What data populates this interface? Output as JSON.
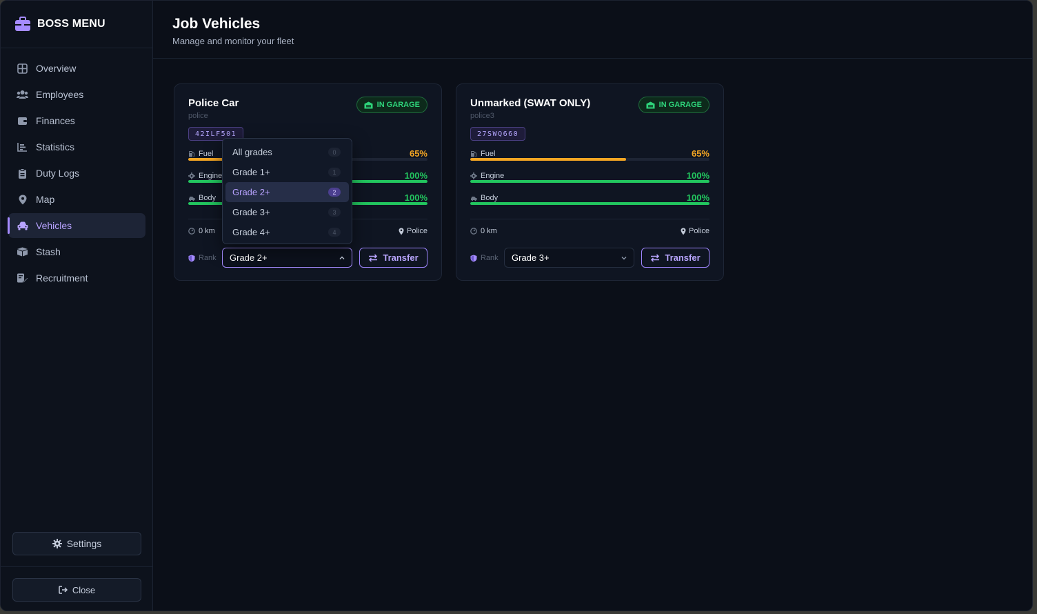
{
  "sidebar": {
    "brand": "BOSS MENU",
    "items": [
      {
        "label": "Overview",
        "icon": "grid-icon"
      },
      {
        "label": "Employees",
        "icon": "users-icon"
      },
      {
        "label": "Finances",
        "icon": "wallet-icon"
      },
      {
        "label": "Statistics",
        "icon": "chart-icon"
      },
      {
        "label": "Duty Logs",
        "icon": "clipboard-icon"
      },
      {
        "label": "Map",
        "icon": "map-pin-icon"
      },
      {
        "label": "Vehicles",
        "icon": "car-icon",
        "active": true
      },
      {
        "label": "Stash",
        "icon": "box-icon"
      },
      {
        "label": "Recruitment",
        "icon": "signature-icon"
      }
    ],
    "settings_label": "Settings",
    "close_label": "Close"
  },
  "header": {
    "title": "Job Vehicles",
    "subtitle": "Manage and monitor your fleet"
  },
  "vehicles": [
    {
      "name": "Police Car",
      "model": "police",
      "plate": "42ILF501",
      "status": "IN GARAGE",
      "fuel": {
        "label": "Fuel",
        "value": "65%",
        "level": 65
      },
      "engine": {
        "label": "Engine",
        "value": "100%",
        "level": 100
      },
      "body": {
        "label": "Body",
        "value": "100%",
        "level": 100
      },
      "mileage": "0 km",
      "location": "Police",
      "rank_label": "Rank",
      "rank": "Grade 2+",
      "transfer_label": "Transfer"
    },
    {
      "name": "Unmarked (SWAT ONLY)",
      "model": "police3",
      "plate": "27SWQ660",
      "status": "IN GARAGE",
      "fuel": {
        "label": "Fuel",
        "value": "65%",
        "level": 65
      },
      "engine": {
        "label": "Engine",
        "value": "100%",
        "level": 100
      },
      "body": {
        "label": "Body",
        "value": "100%",
        "level": 100
      },
      "mileage": "0 km",
      "location": "Police",
      "rank_label": "Rank",
      "rank": "Grade 3+",
      "transfer_label": "Transfer"
    }
  ],
  "rank_dropdown": {
    "options": [
      {
        "label": "All grades",
        "num": "0"
      },
      {
        "label": "Grade 1+",
        "num": "1"
      },
      {
        "label": "Grade 2+",
        "num": "2",
        "selected": true
      },
      {
        "label": "Grade 3+",
        "num": "3"
      },
      {
        "label": "Grade 4+",
        "num": "4"
      }
    ]
  },
  "colors": {
    "accent": "#a58bff",
    "fuel": "#f5a623",
    "good": "#22c55e",
    "garage": "#2ed37a"
  }
}
